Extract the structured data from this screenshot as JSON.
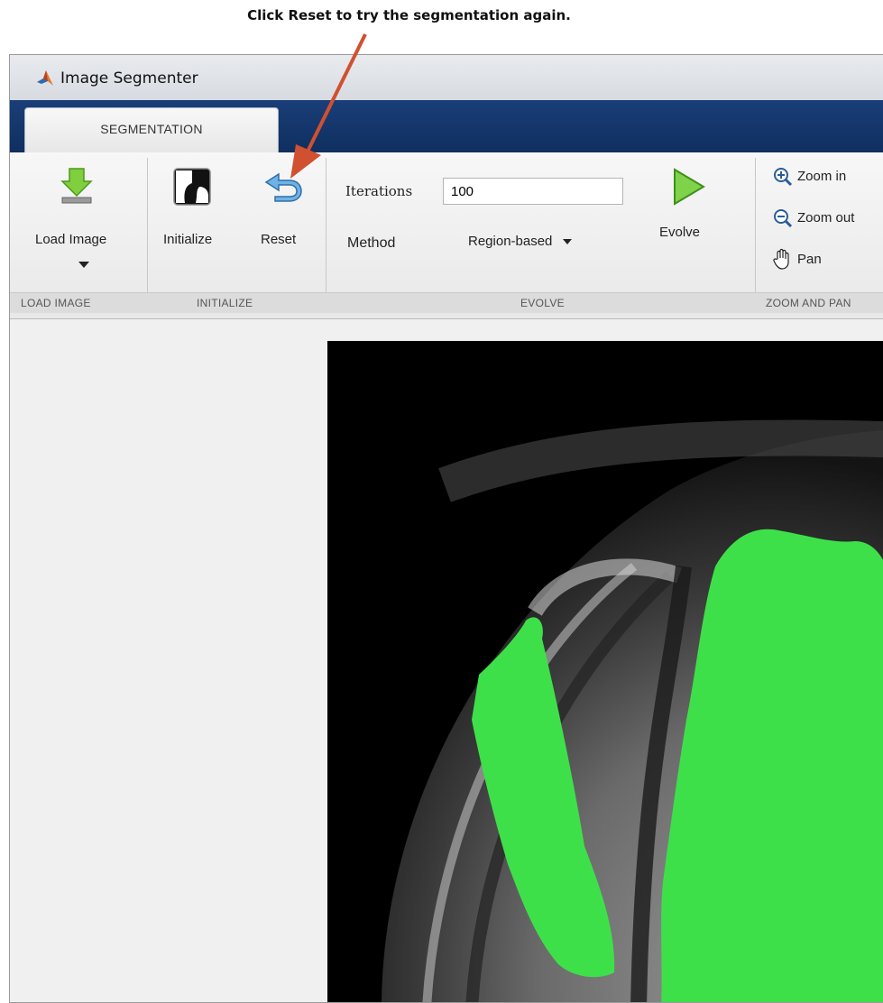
{
  "callout": "Click Reset to try the segmentation again.",
  "window": {
    "title": "Image Segmenter"
  },
  "tab": {
    "label": "SEGMENTATION"
  },
  "load": {
    "button_label": "Load Image",
    "section_label": "LOAD IMAGE"
  },
  "initialize": {
    "initialize_label": "Initialize",
    "reset_label": "Reset",
    "section_label": "INITIALIZE"
  },
  "evolve": {
    "iterations_label": "Iterations",
    "iterations_value": "100",
    "method_label": "Method",
    "method_value": "Region-based",
    "evolve_label": "Evolve",
    "section_label": "EVOLVE"
  },
  "zoom": {
    "zoom_in": "Zoom in",
    "zoom_out": "Zoom out",
    "pan": "Pan",
    "section_label": "ZOOM AND PAN"
  },
  "colors": {
    "accent_blue": "#1a3e78",
    "segmentation_green": "#3ee04a",
    "arrow": "#d0502f"
  }
}
